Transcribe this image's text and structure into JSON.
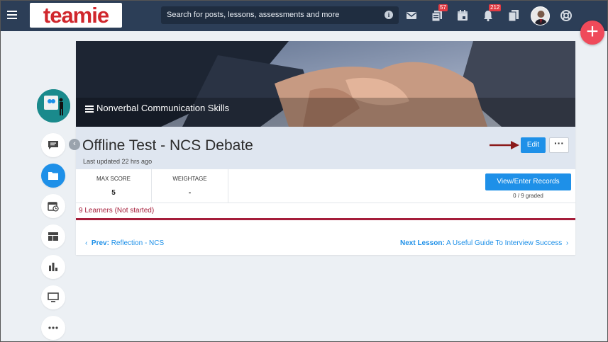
{
  "header": {
    "logo_text": "teamie",
    "search_placeholder": "Search for posts, lessons, assessments and more",
    "badges": {
      "lessons_count": "57",
      "notifications_count": "212"
    },
    "icons": [
      "menu-icon",
      "info-icon",
      "mail-icon",
      "lessons-icon",
      "calendar-icon",
      "bell-icon",
      "files-icon",
      "help-icon"
    ]
  },
  "fab": {
    "symbol": "+"
  },
  "course": {
    "banner_title": "Nonverbal Communication Skills"
  },
  "assessment": {
    "title": "Offline Test - NCS Debate",
    "last_updated": "Last updated 22 hrs ago",
    "edit_label": "Edit",
    "more_label": "···"
  },
  "stats": {
    "max_score_label": "MAX SCORE",
    "max_score_value": "5",
    "weightage_label": "WEIGHTAGE",
    "weightage_value": "-",
    "records_label": "View/Enter Records",
    "graded_text": "0 / 9 graded"
  },
  "learners": {
    "status": "9 Learners (Not started)"
  },
  "navigation": {
    "prev_label": "Prev:",
    "prev_target": "Reflection - NCS",
    "next_label": "Next Lesson:",
    "next_target": "A Useful Guide To Interview Success"
  },
  "colors": {
    "topbar": "#2c3e57",
    "accent": "#1e90e8",
    "fab": "#ef4a5a",
    "learners": "#a51d3a",
    "arrow": "#8b1a1a"
  }
}
